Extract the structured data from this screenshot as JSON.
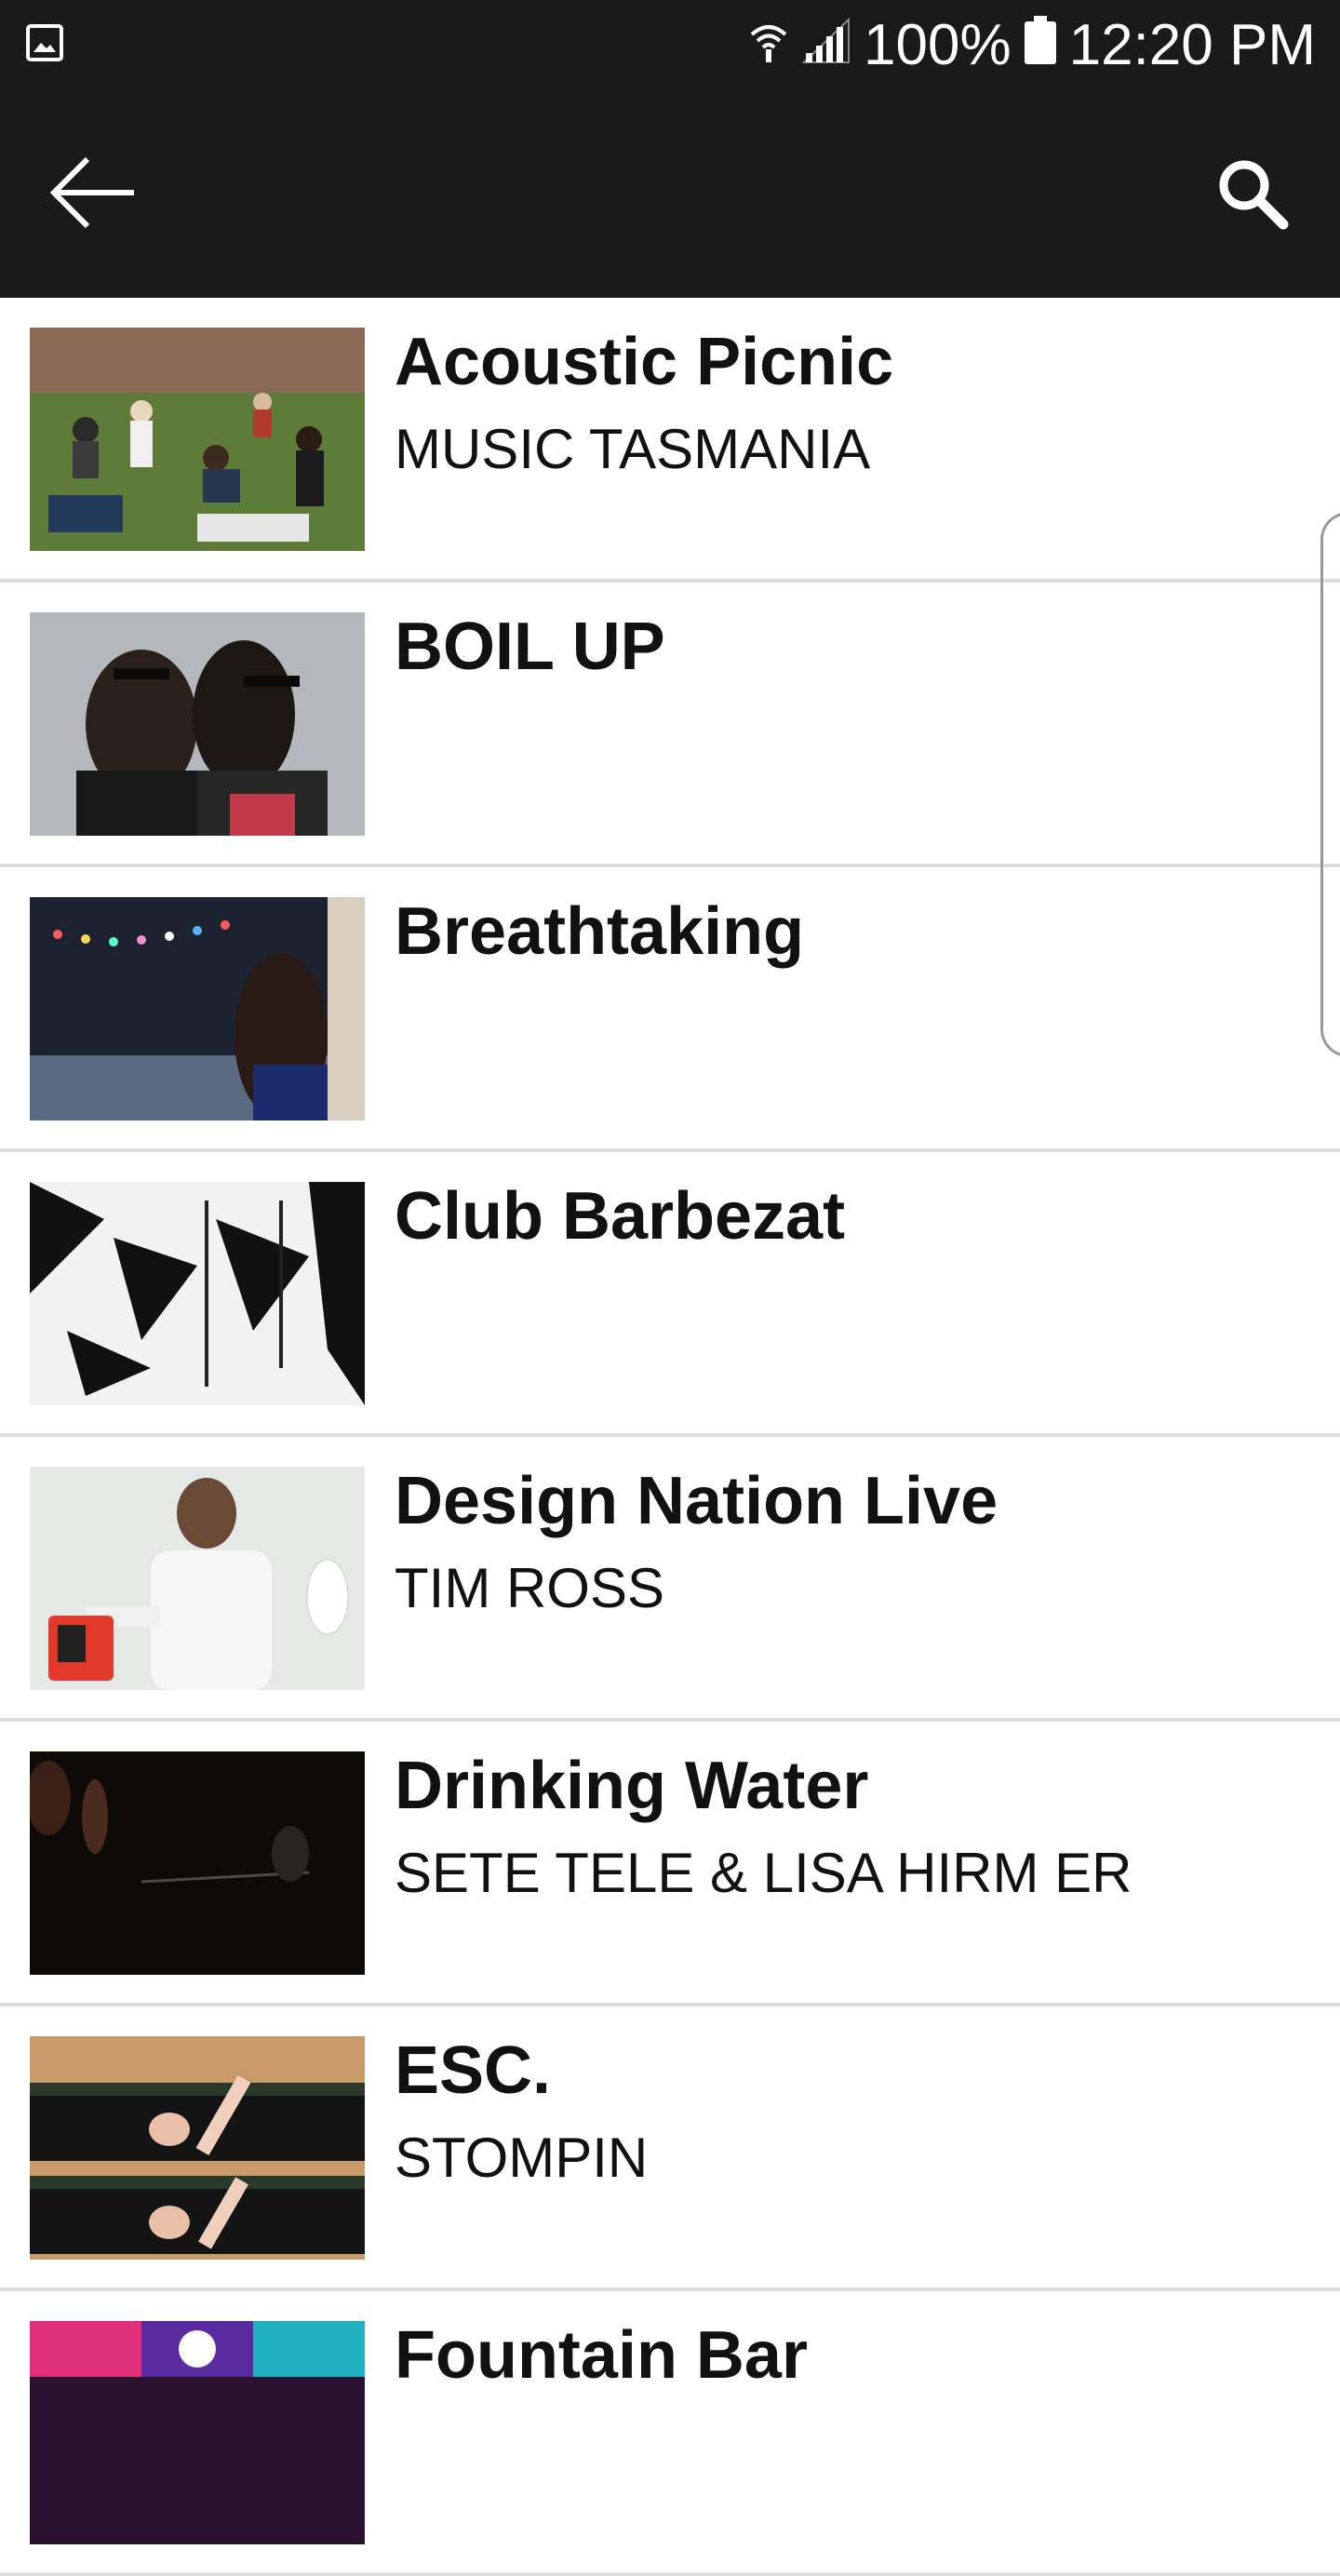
{
  "status_bar": {
    "battery": "100%",
    "time": "12:20 PM"
  },
  "toolbar": {
    "back_icon": "arrow-left-icon",
    "search_icon": "search-icon"
  },
  "events": [
    {
      "title": "Acoustic Picnic",
      "subtitle": "MUSIC TASMANIA",
      "thumb": "crowd-on-lawn"
    },
    {
      "title": "BOIL UP",
      "subtitle": "",
      "thumb": "two-men-sunglasses"
    },
    {
      "title": "Breathtaking",
      "subtitle": "",
      "thumb": "woman-with-string-lights"
    },
    {
      "title": "Club Barbezat",
      "subtitle": "",
      "thumb": "black-white-geometric-room"
    },
    {
      "title": "Design Nation Live",
      "subtitle": "TIM ROSS",
      "thumb": "man-in-white-coat"
    },
    {
      "title": "Drinking Water",
      "subtitle": "SETE TELE & LISA HIRM ER",
      "thumb": "dark-hands"
    },
    {
      "title": "ESC.",
      "subtitle": "STOMPIN",
      "thumb": "people-on-benches"
    },
    {
      "title": "Fountain Bar",
      "subtitle": "",
      "thumb": "colorful-lights"
    }
  ],
  "colors": {
    "app_bar": "#1a1a1a",
    "divider": "#dcdcdc",
    "text": "#111111"
  }
}
